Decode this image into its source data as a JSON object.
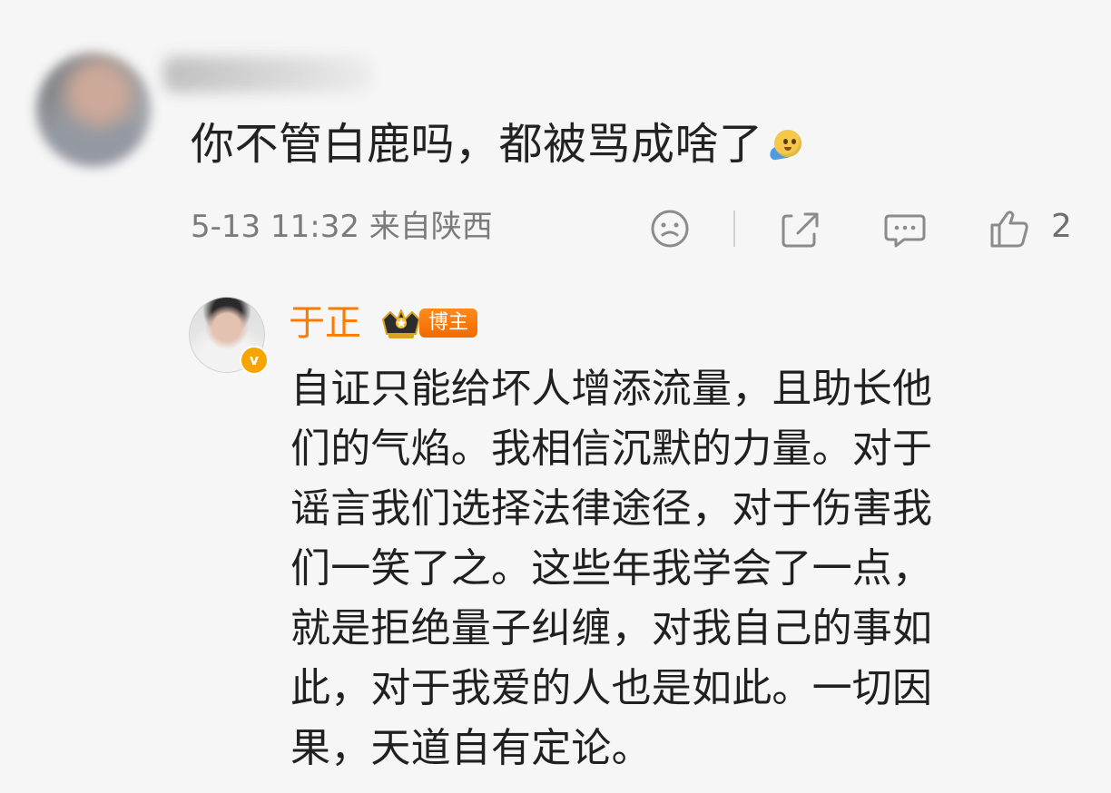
{
  "comment": {
    "text": "你不管白鹿吗，都被骂成啥了",
    "emoji_icon": "facepalm-emoji-icon",
    "meta": "5-13 11:32 来自陕西"
  },
  "actions": {
    "dislike_icon": "sad-face-icon",
    "share_icon": "share-icon",
    "comment_icon": "comment-icon",
    "like_icon": "thumbs-up-icon",
    "like_count": "2"
  },
  "reply": {
    "author": "于正",
    "badge_label": "博主",
    "lines": [
      "自证只能给坏人增添流量，且助长他",
      "们的气焰。我相信沉默的力量。对于",
      "谣言我们选择法律途径，对于伤害我",
      "们一笑了之。这些年我学会了一点，",
      "就是拒绝量子纠缠，对我自己的事如",
      "此，对于我爱的人也是如此。一切因",
      "果，天道自有定论。"
    ]
  },
  "colors": {
    "accent": "#ff7a00",
    "text": "#202020",
    "meta": "#7b7b7b",
    "icon": "#8b8b8b"
  }
}
